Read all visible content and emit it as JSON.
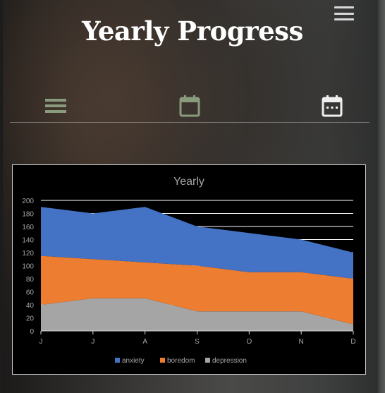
{
  "header": {
    "title": "Yearly Progress",
    "menu_icon": "hamburger-menu-icon"
  },
  "nav": {
    "items": [
      {
        "icon": "list-icon"
      },
      {
        "icon": "calendar-icon"
      },
      {
        "icon": "calendar-month-icon"
      }
    ]
  },
  "colors": {
    "anxiety": "#4472c4",
    "boredom": "#ed7d31",
    "depression": "#a5a5a5",
    "chart_background": "#000000",
    "gridline": "#ffffff",
    "nav_icon_muted": "#8a9a7c",
    "nav_icon_active": "#f0f0f0"
  },
  "chart_data": {
    "type": "area",
    "stacked": true,
    "title": "Yearly",
    "categories": [
      "J",
      "J",
      "A",
      "S",
      "O",
      "N",
      "D"
    ],
    "series": [
      {
        "name": "anxiety",
        "values": [
          75,
          70,
          85,
          60,
          60,
          50,
          40
        ]
      },
      {
        "name": "boredom",
        "values": [
          75,
          60,
          55,
          70,
          60,
          60,
          70
        ]
      },
      {
        "name": "depression",
        "values": [
          40,
          50,
          50,
          30,
          30,
          30,
          10
        ]
      }
    ],
    "yticks": [
      "0",
      "20",
      "40",
      "60",
      "80",
      "100",
      "120",
      "140",
      "160",
      "180",
      "200"
    ],
    "ylim": [
      0,
      200
    ],
    "grid": true,
    "legend": "bottom"
  }
}
